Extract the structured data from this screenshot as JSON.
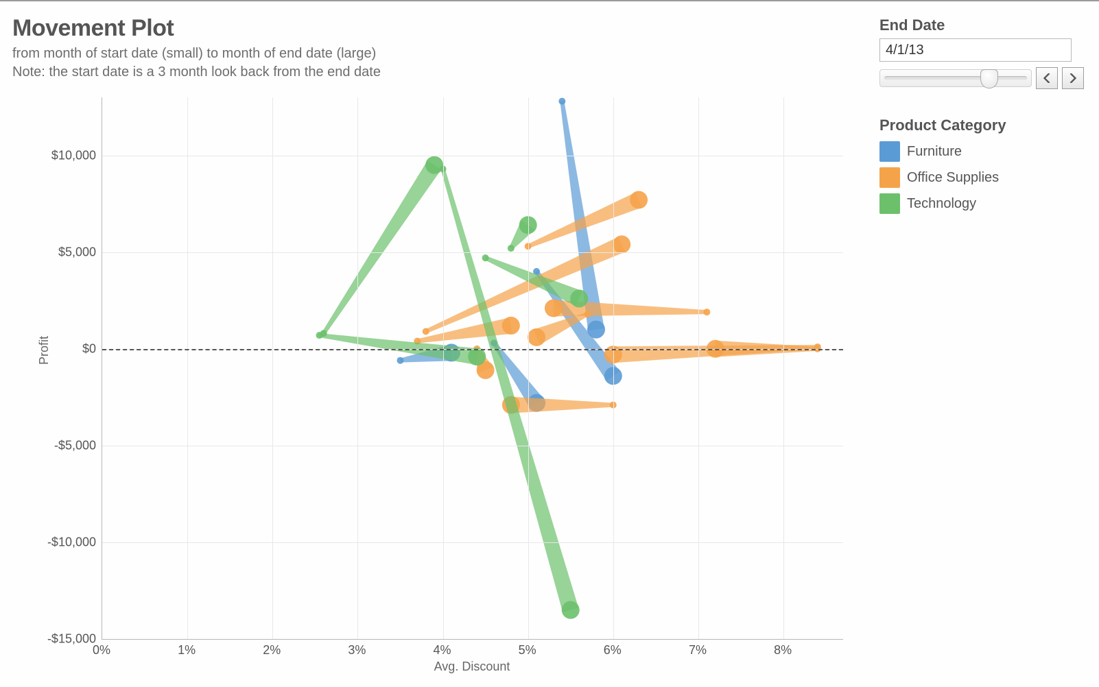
{
  "header": {
    "title": "Movement Plot",
    "subtitle_line1": "from month of start date (small) to month of end date (large)",
    "subtitle_line2": "Note: the start date is a 3 month look back from the end date"
  },
  "controls": {
    "end_date_label": "End Date",
    "end_date_value": "4/1/13",
    "slider_position_pct": 72
  },
  "legend": {
    "title": "Product Category",
    "items": [
      {
        "label": "Furniture",
        "color": "#5b9bd5"
      },
      {
        "label": "Office Supplies",
        "color": "#f5a34a"
      },
      {
        "label": "Technology",
        "color": "#6cc06c"
      }
    ]
  },
  "chart_data": {
    "type": "scatter",
    "title": "Movement Plot",
    "xlabel": "Avg. Discount",
    "ylabel": "Profit",
    "xlim": [
      0,
      8.7
    ],
    "ylim": [
      -15000,
      13000
    ],
    "x_ticks": [
      0,
      1,
      2,
      3,
      4,
      5,
      6,
      7,
      8
    ],
    "x_tick_labels": [
      "0%",
      "1%",
      "2%",
      "3%",
      "4%",
      "5%",
      "6%",
      "7%",
      "8%"
    ],
    "y_ticks": [
      -15000,
      -10000,
      -5000,
      0,
      5000,
      10000
    ],
    "y_tick_labels": [
      "-$15,000",
      "-$10,000",
      "-$5,000",
      "$0",
      "$5,000",
      "$10,000"
    ],
    "zero_line_y": 0,
    "colors": {
      "Furniture": "#5b9bd5",
      "Office Supplies": "#f5a34a",
      "Technology": "#6cc06c"
    },
    "series": [
      {
        "category": "Furniture",
        "start": {
          "x": 5.4,
          "y": 12800
        },
        "end": {
          "x": 5.8,
          "y": 1000
        }
      },
      {
        "category": "Furniture",
        "start": {
          "x": 5.1,
          "y": 4000
        },
        "end": {
          "x": 6.0,
          "y": -1400
        }
      },
      {
        "category": "Furniture",
        "start": {
          "x": 3.5,
          "y": -600
        },
        "end": {
          "x": 4.1,
          "y": -200
        }
      },
      {
        "category": "Furniture",
        "start": {
          "x": 4.6,
          "y": 300
        },
        "end": {
          "x": 5.1,
          "y": -2800
        }
      },
      {
        "category": "Office Supplies",
        "start": {
          "x": 5.0,
          "y": 5300
        },
        "end": {
          "x": 6.3,
          "y": 7700
        }
      },
      {
        "category": "Office Supplies",
        "start": {
          "x": 3.8,
          "y": 900
        },
        "end": {
          "x": 6.1,
          "y": 5400
        }
      },
      {
        "category": "Office Supplies",
        "start": {
          "x": 7.1,
          "y": 1900
        },
        "end": {
          "x": 5.3,
          "y": 2100
        }
      },
      {
        "category": "Office Supplies",
        "start": {
          "x": 3.7,
          "y": 400
        },
        "end": {
          "x": 4.8,
          "y": 1200
        }
      },
      {
        "category": "Office Supplies",
        "start": {
          "x": 5.7,
          "y": 1800
        },
        "end": {
          "x": 5.1,
          "y": 600
        }
      },
      {
        "category": "Office Supplies",
        "start": {
          "x": 8.4,
          "y": 0
        },
        "end": {
          "x": 7.2,
          "y": 0
        }
      },
      {
        "category": "Office Supplies",
        "start": {
          "x": 8.4,
          "y": 100
        },
        "end": {
          "x": 6.0,
          "y": -300
        }
      },
      {
        "category": "Office Supplies",
        "start": {
          "x": 4.4,
          "y": 0
        },
        "end": {
          "x": 4.5,
          "y": -1100
        }
      },
      {
        "category": "Office Supplies",
        "start": {
          "x": 6.0,
          "y": -2900
        },
        "end": {
          "x": 4.8,
          "y": -2900
        }
      },
      {
        "category": "Technology",
        "start": {
          "x": 2.6,
          "y": 800
        },
        "end": {
          "x": 3.9,
          "y": 9500
        }
      },
      {
        "category": "Technology",
        "start": {
          "x": 4.8,
          "y": 5200
        },
        "end": {
          "x": 5.0,
          "y": 6400
        }
      },
      {
        "category": "Technology",
        "start": {
          "x": 2.55,
          "y": 700
        },
        "end": {
          "x": 4.4,
          "y": -400
        }
      },
      {
        "category": "Technology",
        "start": {
          "x": 4.5,
          "y": 4700
        },
        "end": {
          "x": 5.6,
          "y": 2600
        }
      },
      {
        "category": "Technology",
        "start": {
          "x": 4.0,
          "y": 9300
        },
        "end": {
          "x": 5.5,
          "y": -13500
        }
      }
    ]
  }
}
